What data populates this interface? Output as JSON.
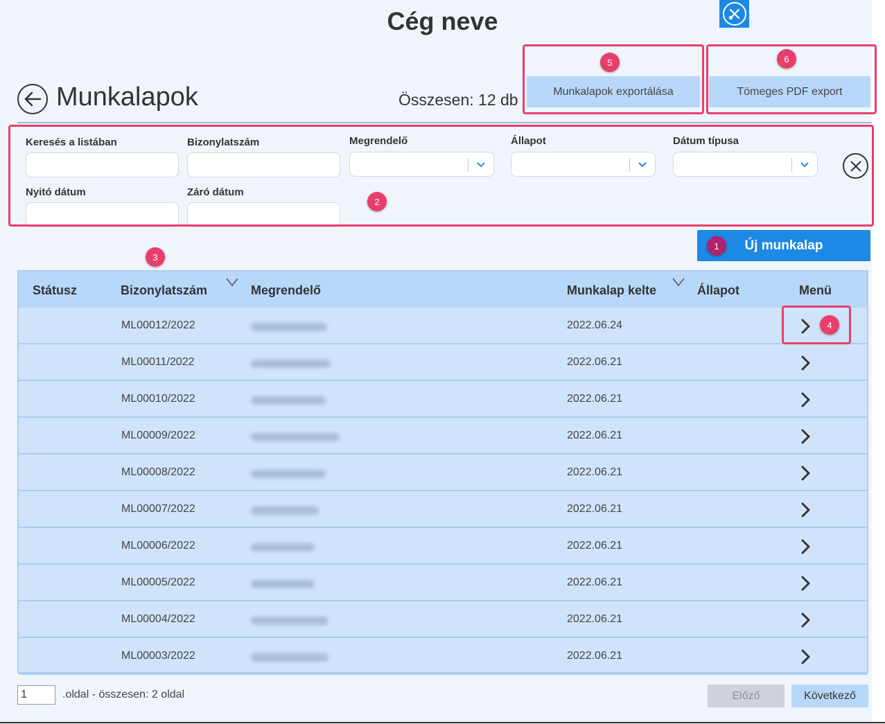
{
  "header": {
    "company_name": "Cég neve",
    "page_title": "Munkalapok",
    "total": "Összesen: 12 db",
    "export_button": "Munkalapok exportálása",
    "pdf_export_button": "Tömeges PDF export"
  },
  "filters": {
    "search_label": "Keresés a listában",
    "doc_number_label": "Bizonylatszám",
    "customer_label": "Megrendelő",
    "status_label": "Állapot",
    "date_type_label": "Dátum típusa",
    "start_date_label": "Nyitó dátum",
    "end_date_label": "Záró dátum"
  },
  "new_button": "Új munkalap",
  "badges": [
    "1",
    "2",
    "3",
    "4",
    "5",
    "6"
  ],
  "table": {
    "headers": {
      "status": "Státusz",
      "doc_number": "Bizonylatszám",
      "customer": "Megrendelő",
      "date": "Munkalap kelte",
      "state": "Állapot",
      "menu": "Menü"
    },
    "rows": [
      {
        "doc": "ML00012/2022",
        "date": "2022.06.24"
      },
      {
        "doc": "ML00011/2022",
        "date": "2022.06.21"
      },
      {
        "doc": "ML00010/2022",
        "date": "2022.06.21"
      },
      {
        "doc": "ML00009/2022",
        "date": "2022.06.21"
      },
      {
        "doc": "ML00008/2022",
        "date": "2022.06.21"
      },
      {
        "doc": "ML00007/2022",
        "date": "2022.06.21"
      },
      {
        "doc": "ML00006/2022",
        "date": "2022.06.21"
      },
      {
        "doc": "ML00005/2022",
        "date": "2022.06.21"
      },
      {
        "doc": "ML00004/2022",
        "date": "2022.06.21"
      },
      {
        "doc": "ML00003/2022",
        "date": "2022.06.21"
      }
    ]
  },
  "pager": {
    "page_value": "1",
    "page_text": ".oldal - összesen: 2 oldal",
    "prev": "Előző",
    "next": "Következő"
  },
  "colors": {
    "accent": "#1e88e5",
    "highlight": "#e83e6c",
    "table_bg": "#cfe4fb",
    "header_bg": "#b8d8fa"
  }
}
